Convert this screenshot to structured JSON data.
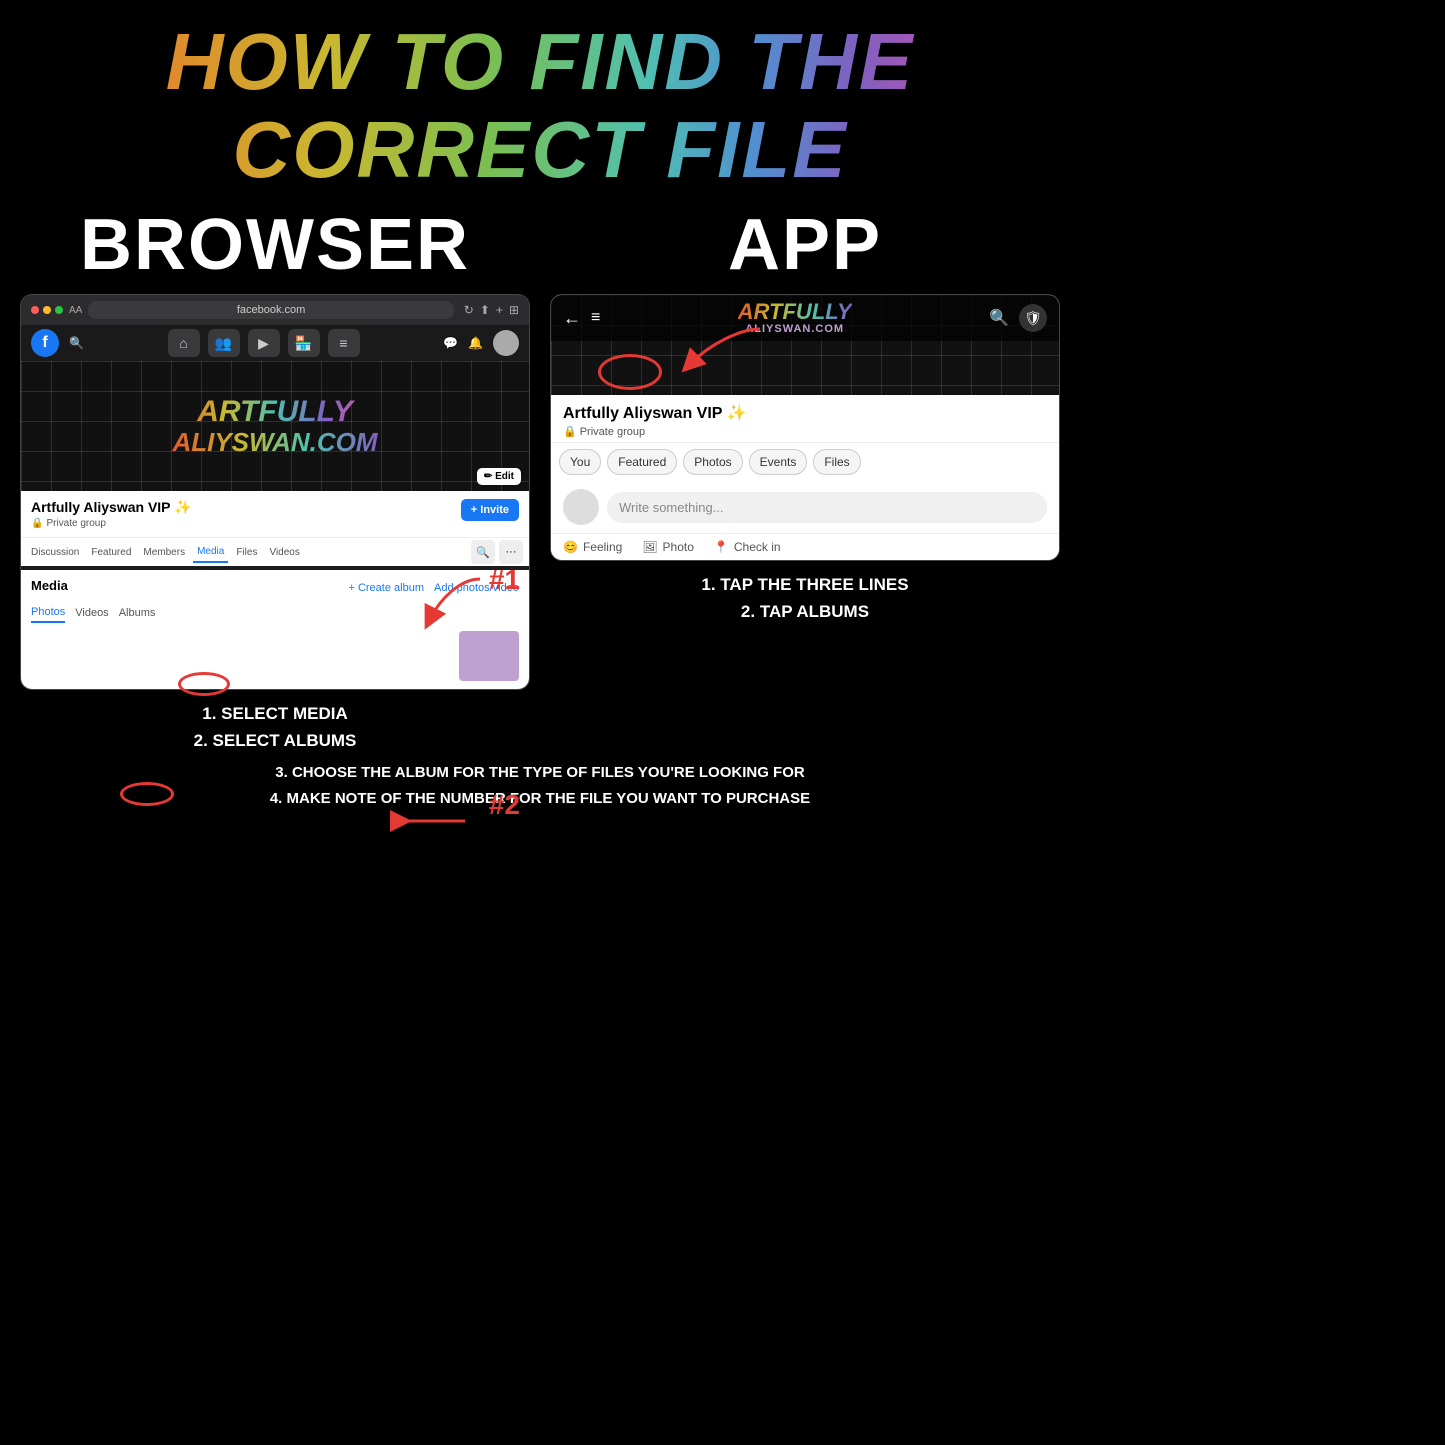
{
  "title": {
    "line1": "HOW TO FIND THE CORRECT FILE"
  },
  "browser": {
    "column_title": "BROWSER",
    "url": "facebook.com",
    "group_name": "Artfully Aliyswan VIP ✨",
    "private_label": "Private group",
    "nav_items": [
      "Discussion",
      "Featured",
      "Members",
      "Media",
      "Files",
      "Videos"
    ],
    "media_label": "Media",
    "create_album_label": "+ Create album",
    "add_photos_label": "Add photos/video",
    "media_tabs": [
      "Photos",
      "Videos",
      "Albums"
    ],
    "annotation_1": "#1",
    "annotation_2": "#2",
    "edit_label": "✏ Edit"
  },
  "app": {
    "column_title": "APP",
    "header_title": "ARTFULLY",
    "header_subtitle": "ALIYSWAN.COM",
    "group_name": "Artfully Aliyswan VIP ✨",
    "private_label": "Private group",
    "tabs": [
      "You",
      "Featured",
      "Photos",
      "Events",
      "Files"
    ],
    "write_placeholder": "Write something...",
    "feeling_label": "Feeling",
    "photo_label": "Photo",
    "checkin_label": "Check in"
  },
  "instructions": {
    "browser_line1": "1. SELECT MEDIA",
    "browser_line2": "2. SELECT ALBUMS",
    "app_line1": "1. TAP THE THREE LINES",
    "app_line2": "2. TAP ALBUMS",
    "bottom_line": "3. CHOOSE THE ALBUM FOR THE TYPE OF FILES YOU'RE LOOKING FOR",
    "bottom_line2": "4. MAKE NOTE OF THE NUMBER FOR THE FILE YOU WANT TO PURCHASE"
  }
}
